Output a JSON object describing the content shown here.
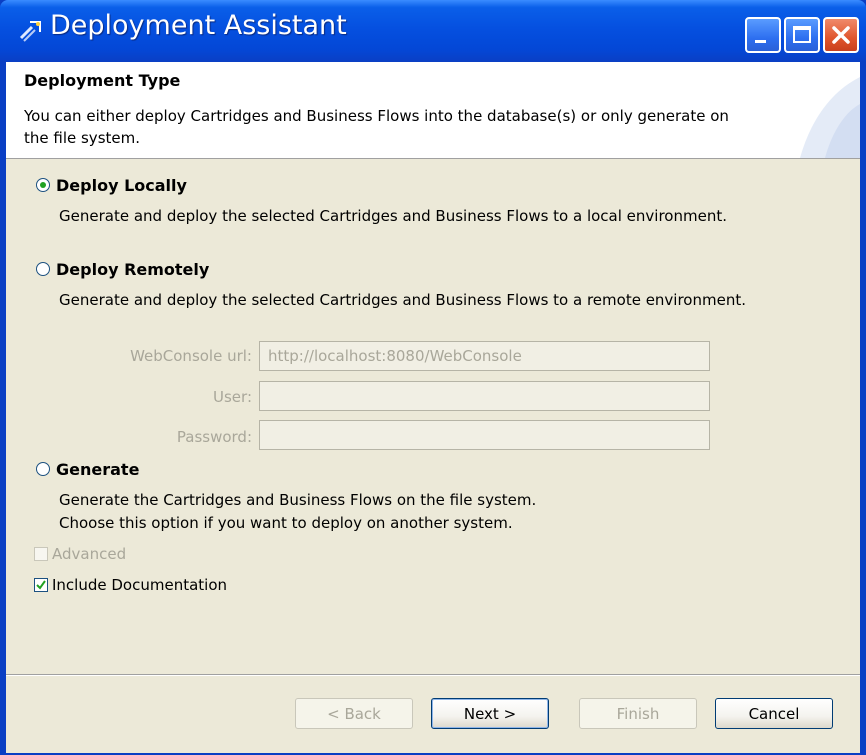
{
  "window": {
    "title": "Deployment Assistant",
    "controls": [
      "minimize-icon",
      "maximize-icon",
      "close-icon"
    ]
  },
  "banner": {
    "title": "Deployment Type",
    "description": "You can either deploy Cartridges and Business Flows into the database(s) or only generate on the file system."
  },
  "options": [
    {
      "label": "Deploy Locally",
      "selected": true,
      "description": "Generate and deploy the selected Cartridges and Business Flows to a local environment."
    },
    {
      "label": "Deploy Remotely",
      "selected": false,
      "description": "Generate and deploy the selected Cartridges and Business Flows to a remote environment."
    },
    {
      "label": "Generate",
      "selected": false,
      "description_line1": "Generate the Cartridges and Business Flows on the file system.",
      "description_line2": "Choose this option if you want to deploy on another system."
    }
  ],
  "remote_fields": {
    "webconsole_label": "WebConsole url:",
    "webconsole_value": "http://localhost:8080/WebConsole",
    "user_label": "User:",
    "user_value": "",
    "password_label": "Password:",
    "password_value": ""
  },
  "checkboxes": {
    "advanced": {
      "label": "Advanced",
      "checked": false,
      "enabled": false
    },
    "include_documentation": {
      "label": "Include Documentation",
      "checked": true,
      "enabled": true
    }
  },
  "buttons": {
    "back": "< Back",
    "next": "Next >",
    "finish": "Finish",
    "cancel": "Cancel"
  },
  "colors": {
    "titlebar": "#0550e0",
    "dialog_bg": "#ece9d8",
    "close_button": "#e0552d",
    "radio_dot": "#21a121",
    "disabled_text": "#a9a79a"
  }
}
